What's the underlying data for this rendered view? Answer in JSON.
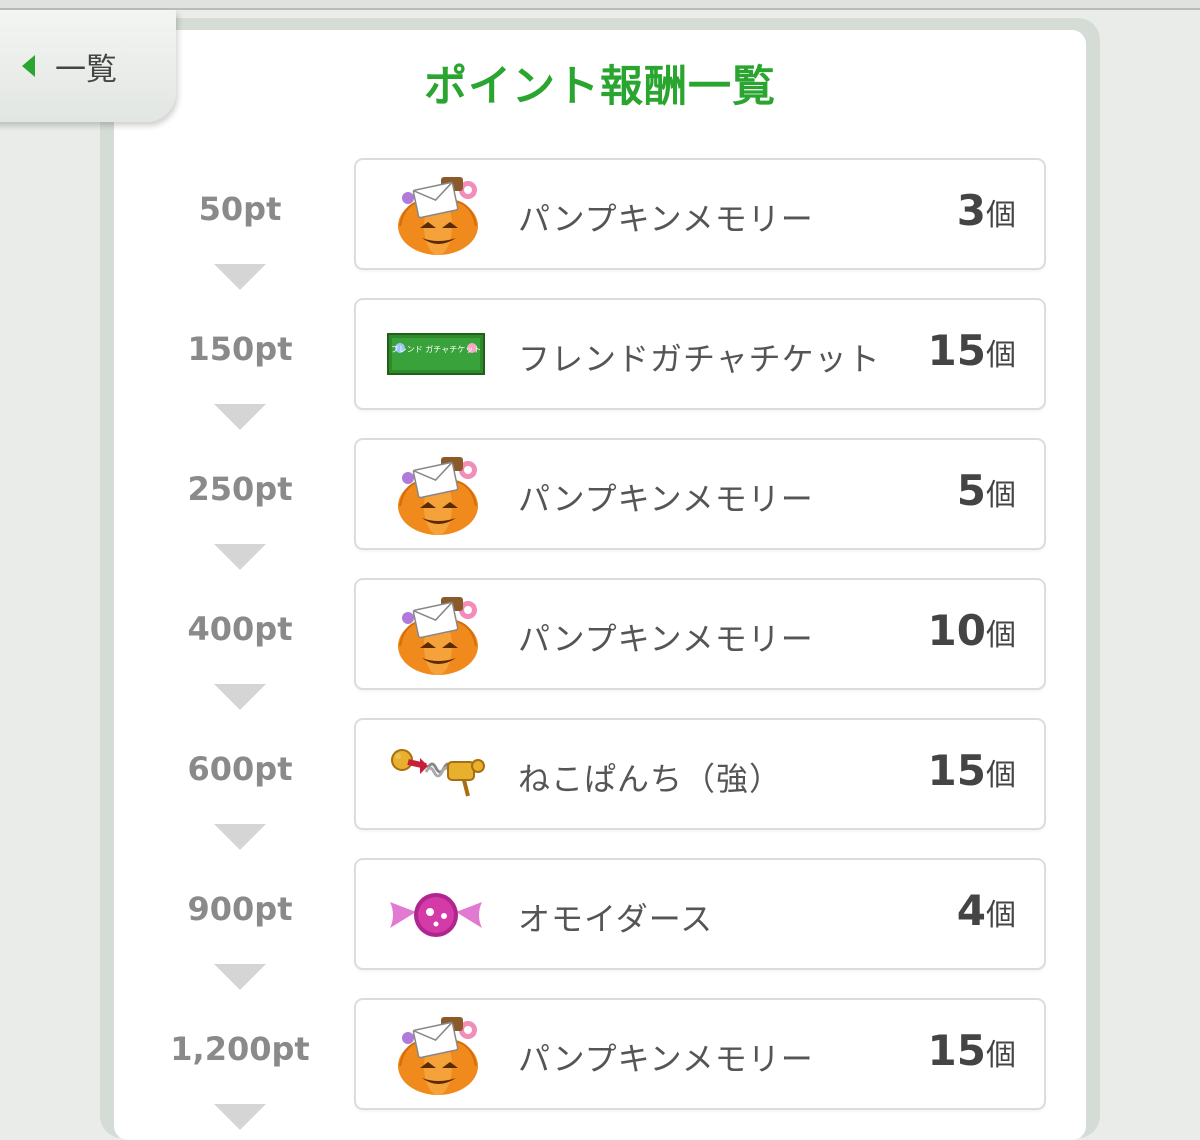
{
  "back": {
    "label": "一覧"
  },
  "title": "ポイント報酬一覧",
  "rewards": [
    {
      "points": "50pt",
      "icon": "pumpkin-memory-icon",
      "name": "パンプキンメモリー",
      "count": "3",
      "unit": "個"
    },
    {
      "points": "150pt",
      "icon": "friend-gacha-ticket-icon",
      "name": "フレンドガチャチケット",
      "count": "15",
      "unit": "個",
      "ticket_text": "フレンド ガチャチケット"
    },
    {
      "points": "250pt",
      "icon": "pumpkin-memory-icon",
      "name": "パンプキンメモリー",
      "count": "5",
      "unit": "個"
    },
    {
      "points": "400pt",
      "icon": "pumpkin-memory-icon",
      "name": "パンプキンメモリー",
      "count": "10",
      "unit": "個"
    },
    {
      "points": "600pt",
      "icon": "cat-punch-icon",
      "name": "ねこぱんち（強）",
      "count": "15",
      "unit": "個"
    },
    {
      "points": "900pt",
      "icon": "omoidasu-candy-icon",
      "name": "オモイダース",
      "count": "4",
      "unit": "個"
    },
    {
      "points": "1,200pt",
      "icon": "pumpkin-memory-icon",
      "name": "パンプキンメモリー",
      "count": "15",
      "unit": "個"
    }
  ],
  "colors": {
    "accent": "#2aa530",
    "points_text": "#8a8a8a",
    "card_border": "#dcdcdc"
  }
}
